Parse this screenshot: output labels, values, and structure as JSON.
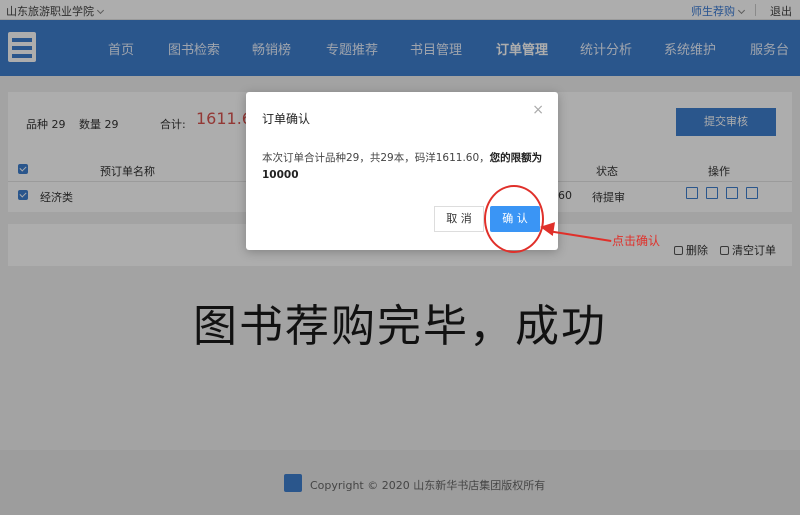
{
  "topbar": {
    "school": "山东旅游职业学院",
    "user": "师生荐购",
    "logout": "退出"
  },
  "nav": {
    "items": [
      "首页",
      "图书检索",
      "畅销榜",
      "专题推荐",
      "书目管理",
      "订单管理",
      "统计分析",
      "系统维护",
      "服务台"
    ],
    "active": "订单管理"
  },
  "order": {
    "variety_label": "品种 29",
    "quantity_label": "数量 29",
    "total_label": "合计:",
    "total_value": "1611.60",
    "submit_label": "提交审核"
  },
  "table": {
    "headers": {
      "name": "预订单名称",
      "status": "状态",
      "ops": "操作"
    },
    "row": {
      "name": "经济类",
      "amount_tail": "60",
      "status": "待提审"
    }
  },
  "actions": {
    "delete": "删除",
    "clear": "清空订单"
  },
  "footer": {
    "copyright": "Copyright © 2020 山东新华书店集团版权所有"
  },
  "caption": "图书荐购完毕，成功",
  "modal": {
    "title": "订单确认",
    "close": "×",
    "message": "本次订单合计品种29，共29本，码洋1611.60，",
    "message_bold": "您的限额为10000",
    "cancel": "取 消",
    "confirm": "确 认"
  },
  "annotation": {
    "text": "点击确认",
    "color": "#e0302a"
  },
  "colors": {
    "primary": "#3f7fcf",
    "confirm": "#3a95f5",
    "price": "#d9534f"
  }
}
